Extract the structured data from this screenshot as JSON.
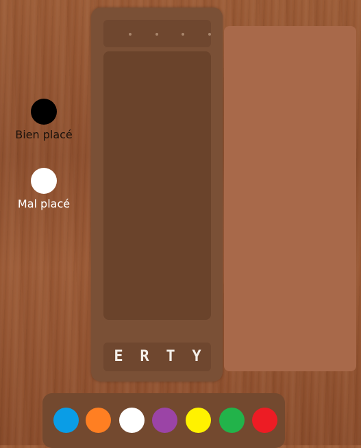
{
  "legend": {
    "black": {
      "label": "Bien placé",
      "color": "#000000"
    },
    "white": {
      "label": "Mal placé",
      "color": "#ffffff"
    }
  },
  "board": {
    "hidden_code_slots": 4,
    "keys": [
      "E",
      "R",
      "T",
      "Y"
    ]
  },
  "palette": {
    "colors": [
      {
        "name": "blue",
        "hex": "#0a9de6"
      },
      {
        "name": "orange",
        "hex": "#ff7f22"
      },
      {
        "name": "white",
        "hex": "#ffffff"
      },
      {
        "name": "purple",
        "hex": "#9b44a6"
      },
      {
        "name": "yellow",
        "hex": "#fff200"
      },
      {
        "name": "green",
        "hex": "#22b34a"
      },
      {
        "name": "red",
        "hex": "#ed1c24"
      }
    ]
  }
}
